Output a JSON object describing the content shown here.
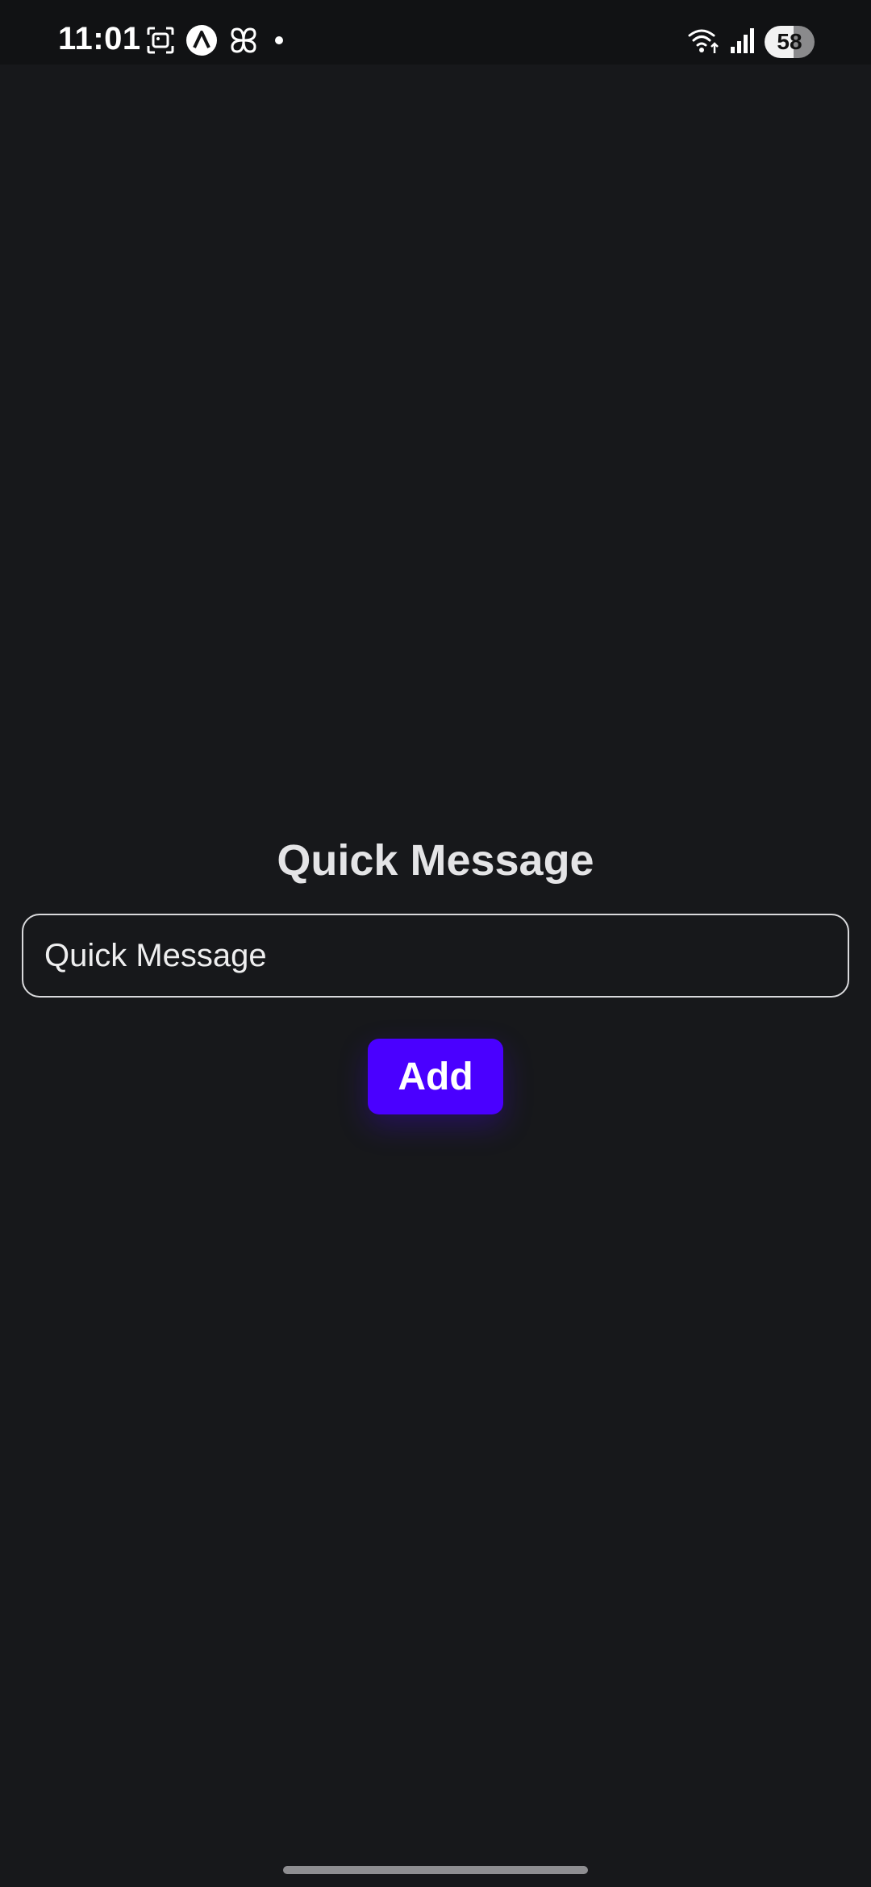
{
  "status_bar": {
    "time": "11:01",
    "battery_level": "58",
    "left_icons": [
      "screenshot-icon",
      "app-a-icon",
      "pinwheel-icon",
      "notification-dot-icon"
    ],
    "right_icons": [
      "wifi-icon",
      "signal-icon",
      "battery-icon"
    ]
  },
  "main": {
    "title": "Quick Message",
    "input_value": "",
    "input_placeholder": "Quick Message",
    "add_label": "Add"
  },
  "colors": {
    "background": "#17181b",
    "accent": "#4a00ff",
    "text": "#e8e8ea"
  }
}
